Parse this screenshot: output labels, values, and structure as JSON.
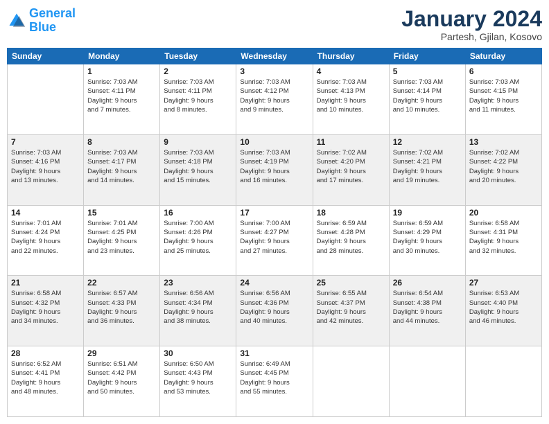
{
  "logo": {
    "text_general": "General",
    "text_blue": "Blue"
  },
  "header": {
    "month": "January 2024",
    "location": "Partesh, Gjilan, Kosovo"
  },
  "weekdays": [
    "Sunday",
    "Monday",
    "Tuesday",
    "Wednesday",
    "Thursday",
    "Friday",
    "Saturday"
  ],
  "weeks": [
    [
      {
        "day": "",
        "sunrise": "",
        "sunset": "",
        "daylight": ""
      },
      {
        "day": "1",
        "sunrise": "Sunrise: 7:03 AM",
        "sunset": "Sunset: 4:11 PM",
        "daylight": "Daylight: 9 hours and 7 minutes."
      },
      {
        "day": "2",
        "sunrise": "Sunrise: 7:03 AM",
        "sunset": "Sunset: 4:11 PM",
        "daylight": "Daylight: 9 hours and 8 minutes."
      },
      {
        "day": "3",
        "sunrise": "Sunrise: 7:03 AM",
        "sunset": "Sunset: 4:12 PM",
        "daylight": "Daylight: 9 hours and 9 minutes."
      },
      {
        "day": "4",
        "sunrise": "Sunrise: 7:03 AM",
        "sunset": "Sunset: 4:13 PM",
        "daylight": "Daylight: 9 hours and 10 minutes."
      },
      {
        "day": "5",
        "sunrise": "Sunrise: 7:03 AM",
        "sunset": "Sunset: 4:14 PM",
        "daylight": "Daylight: 9 hours and 10 minutes."
      },
      {
        "day": "6",
        "sunrise": "Sunrise: 7:03 AM",
        "sunset": "Sunset: 4:15 PM",
        "daylight": "Daylight: 9 hours and 11 minutes."
      }
    ],
    [
      {
        "day": "7",
        "sunrise": "Sunrise: 7:03 AM",
        "sunset": "Sunset: 4:16 PM",
        "daylight": "Daylight: 9 hours and 13 minutes."
      },
      {
        "day": "8",
        "sunrise": "Sunrise: 7:03 AM",
        "sunset": "Sunset: 4:17 PM",
        "daylight": "Daylight: 9 hours and 14 minutes."
      },
      {
        "day": "9",
        "sunrise": "Sunrise: 7:03 AM",
        "sunset": "Sunset: 4:18 PM",
        "daylight": "Daylight: 9 hours and 15 minutes."
      },
      {
        "day": "10",
        "sunrise": "Sunrise: 7:03 AM",
        "sunset": "Sunset: 4:19 PM",
        "daylight": "Daylight: 9 hours and 16 minutes."
      },
      {
        "day": "11",
        "sunrise": "Sunrise: 7:02 AM",
        "sunset": "Sunset: 4:20 PM",
        "daylight": "Daylight: 9 hours and 17 minutes."
      },
      {
        "day": "12",
        "sunrise": "Sunrise: 7:02 AM",
        "sunset": "Sunset: 4:21 PM",
        "daylight": "Daylight: 9 hours and 19 minutes."
      },
      {
        "day": "13",
        "sunrise": "Sunrise: 7:02 AM",
        "sunset": "Sunset: 4:22 PM",
        "daylight": "Daylight: 9 hours and 20 minutes."
      }
    ],
    [
      {
        "day": "14",
        "sunrise": "Sunrise: 7:01 AM",
        "sunset": "Sunset: 4:24 PM",
        "daylight": "Daylight: 9 hours and 22 minutes."
      },
      {
        "day": "15",
        "sunrise": "Sunrise: 7:01 AM",
        "sunset": "Sunset: 4:25 PM",
        "daylight": "Daylight: 9 hours and 23 minutes."
      },
      {
        "day": "16",
        "sunrise": "Sunrise: 7:00 AM",
        "sunset": "Sunset: 4:26 PM",
        "daylight": "Daylight: 9 hours and 25 minutes."
      },
      {
        "day": "17",
        "sunrise": "Sunrise: 7:00 AM",
        "sunset": "Sunset: 4:27 PM",
        "daylight": "Daylight: 9 hours and 27 minutes."
      },
      {
        "day": "18",
        "sunrise": "Sunrise: 6:59 AM",
        "sunset": "Sunset: 4:28 PM",
        "daylight": "Daylight: 9 hours and 28 minutes."
      },
      {
        "day": "19",
        "sunrise": "Sunrise: 6:59 AM",
        "sunset": "Sunset: 4:29 PM",
        "daylight": "Daylight: 9 hours and 30 minutes."
      },
      {
        "day": "20",
        "sunrise": "Sunrise: 6:58 AM",
        "sunset": "Sunset: 4:31 PM",
        "daylight": "Daylight: 9 hours and 32 minutes."
      }
    ],
    [
      {
        "day": "21",
        "sunrise": "Sunrise: 6:58 AM",
        "sunset": "Sunset: 4:32 PM",
        "daylight": "Daylight: 9 hours and 34 minutes."
      },
      {
        "day": "22",
        "sunrise": "Sunrise: 6:57 AM",
        "sunset": "Sunset: 4:33 PM",
        "daylight": "Daylight: 9 hours and 36 minutes."
      },
      {
        "day": "23",
        "sunrise": "Sunrise: 6:56 AM",
        "sunset": "Sunset: 4:34 PM",
        "daylight": "Daylight: 9 hours and 38 minutes."
      },
      {
        "day": "24",
        "sunrise": "Sunrise: 6:56 AM",
        "sunset": "Sunset: 4:36 PM",
        "daylight": "Daylight: 9 hours and 40 minutes."
      },
      {
        "day": "25",
        "sunrise": "Sunrise: 6:55 AM",
        "sunset": "Sunset: 4:37 PM",
        "daylight": "Daylight: 9 hours and 42 minutes."
      },
      {
        "day": "26",
        "sunrise": "Sunrise: 6:54 AM",
        "sunset": "Sunset: 4:38 PM",
        "daylight": "Daylight: 9 hours and 44 minutes."
      },
      {
        "day": "27",
        "sunrise": "Sunrise: 6:53 AM",
        "sunset": "Sunset: 4:40 PM",
        "daylight": "Daylight: 9 hours and 46 minutes."
      }
    ],
    [
      {
        "day": "28",
        "sunrise": "Sunrise: 6:52 AM",
        "sunset": "Sunset: 4:41 PM",
        "daylight": "Daylight: 9 hours and 48 minutes."
      },
      {
        "day": "29",
        "sunrise": "Sunrise: 6:51 AM",
        "sunset": "Sunset: 4:42 PM",
        "daylight": "Daylight: 9 hours and 50 minutes."
      },
      {
        "day": "30",
        "sunrise": "Sunrise: 6:50 AM",
        "sunset": "Sunset: 4:43 PM",
        "daylight": "Daylight: 9 hours and 53 minutes."
      },
      {
        "day": "31",
        "sunrise": "Sunrise: 6:49 AM",
        "sunset": "Sunset: 4:45 PM",
        "daylight": "Daylight: 9 hours and 55 minutes."
      },
      {
        "day": "",
        "sunrise": "",
        "sunset": "",
        "daylight": ""
      },
      {
        "day": "",
        "sunrise": "",
        "sunset": "",
        "daylight": ""
      },
      {
        "day": "",
        "sunrise": "",
        "sunset": "",
        "daylight": ""
      }
    ]
  ]
}
